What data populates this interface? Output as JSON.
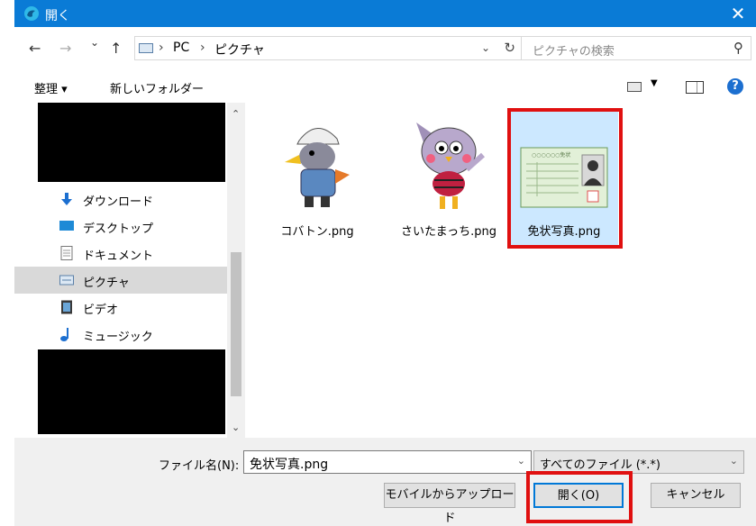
{
  "window": {
    "title": "開く",
    "close_glyph": "✕"
  },
  "nav": {
    "back": "←",
    "forward": "→",
    "recent": "⌄",
    "up": "↑",
    "breadcrumb": [
      "PC",
      "ピクチャ"
    ],
    "separator": "›",
    "search_placeholder": "ピクチャの検索"
  },
  "toolbar": {
    "organize": "整理 ▾",
    "new_folder": "新しいフォルダー",
    "help": "?"
  },
  "sidebar": {
    "items": [
      {
        "label": "ダウンロード",
        "icon": "download-icon"
      },
      {
        "label": "デスクトップ",
        "icon": "desktop-icon"
      },
      {
        "label": "ドキュメント",
        "icon": "document-icon"
      },
      {
        "label": "ピクチャ",
        "icon": "pictures-icon",
        "selected": true
      },
      {
        "label": "ビデオ",
        "icon": "video-icon"
      },
      {
        "label": "ミュージック",
        "icon": "music-icon"
      }
    ]
  },
  "files": [
    {
      "name": "コバトン.png",
      "icon": "kobaton-image"
    },
    {
      "name": "さいたまっち.png",
      "icon": "saitamacchi-image"
    },
    {
      "name": "免状写真.png",
      "icon": "license-card-image",
      "selected": true
    }
  ],
  "license_card": {
    "header": "○○○○○○免状"
  },
  "bottom": {
    "filename_label": "ファイル名(N):",
    "filename_value": "免状写真.png",
    "filetype": "すべてのファイル (*.*)",
    "upload_button": "モバイルからアップロード",
    "open_button": "開く(O)",
    "cancel_button": "キャンセル"
  },
  "colors": {
    "titlebar": "#0a7bd6",
    "highlight": "#e01010",
    "selection": "#cce8ff"
  }
}
